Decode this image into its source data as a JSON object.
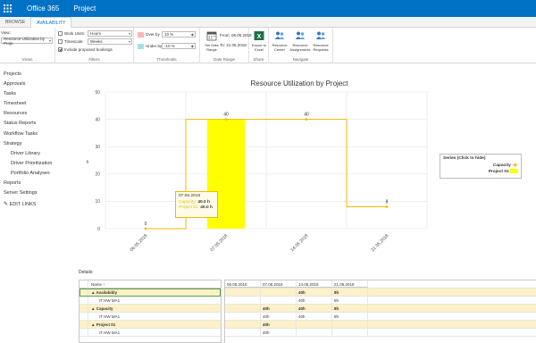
{
  "topbar": {
    "brand": "Office 365",
    "app": "Project"
  },
  "ribbon_tabs": [
    {
      "label": "BROWSE"
    },
    {
      "label": "AVAILABILITY"
    }
  ],
  "ribbon": {
    "views": {
      "view_label": "View:",
      "view_value": "Resource Utilization by Proje",
      "group_label": "Views"
    },
    "filters": {
      "work_units_label": "Work Units:",
      "work_units_value": "Hours",
      "timescale_label": "Timescale:",
      "timescale_value": "Weeks",
      "include_label": "Include proposed bookings",
      "group_label": "Filters"
    },
    "thresholds": {
      "over_label": "Over by",
      "over_value": "10 %",
      "under_label": "Under by",
      "under_value": "-10 %",
      "group_label": "Thresholds"
    },
    "date_range": {
      "button_label": "Set Date Range",
      "from_label": "From:",
      "from_value": "06.05.2018",
      "to_label": "To:",
      "to_value": "21.05.2018",
      "group_label": "Date Range"
    },
    "share": {
      "export_label": "Export to Excel",
      "group_label": "Share"
    },
    "navigate": {
      "center_label": "Resource Center",
      "assign_label": "Resource Assignments",
      "requests_label": "Resource Requests",
      "group_label": "Navigate"
    }
  },
  "quick_launch": [
    {
      "label": "Projects"
    },
    {
      "label": "Approvals"
    },
    {
      "label": "Tasks"
    },
    {
      "label": "Timesheet"
    },
    {
      "label": "Resources"
    },
    {
      "label": "Status Reports"
    },
    {
      "label": "Workflow Tasks"
    },
    {
      "label": "Strategy"
    },
    {
      "label": "Driver Library"
    },
    {
      "label": "Driver Prioritization"
    },
    {
      "label": "Portfolio Analyses"
    },
    {
      "label": "Reports"
    },
    {
      "label": "Server Settings"
    }
  ],
  "edit_links": "EDIT LINKS",
  "chart_data": {
    "type": "bar",
    "title": "Resource Utilization by Project",
    "ylabel": "h",
    "categories": [
      "06.05.2018",
      "07.05.2018",
      "14.05.2018",
      "21.05.2018"
    ],
    "ylim": [
      0,
      50
    ],
    "yticks": [
      0,
      10,
      20,
      30,
      40,
      50
    ],
    "series": [
      {
        "name": "Capacity",
        "type": "step-line",
        "color": "#f5b800",
        "values": [
          0,
          40,
          40,
          8
        ],
        "labels": [
          "0",
          "40",
          "40",
          "8"
        ]
      },
      {
        "name": "Project 01",
        "type": "bar",
        "color": "#ffff00",
        "values": [
          0,
          40,
          0,
          0
        ]
      }
    ],
    "legend": {
      "title": "Series (Click to hide)",
      "position": "right"
    },
    "tooltip": {
      "date": "07.05.2018",
      "capacity_label": "Capacity:",
      "capacity_value": "40.0 h",
      "project_label": "Project 01:",
      "project_value": "40.0 h"
    }
  },
  "details": {
    "label": "Details:",
    "left_header": "Name ↑",
    "rows": [
      {
        "name": "▲ Availability",
        "group": true,
        "selected": true
      },
      {
        "name": "IT HW MA1",
        "group": false
      },
      {
        "name": "▲ Capacity",
        "group": true
      },
      {
        "name": "IT HW MA1",
        "group": false
      },
      {
        "name": "▲ Project 01",
        "group": true
      },
      {
        "name": "IT HW MA1",
        "group": false
      }
    ],
    "columns": [
      "06.05.2018",
      "07.05.2018",
      "14.05.2018",
      "21.05.2018"
    ],
    "cells": [
      [
        "",
        "",
        "40h",
        "8h"
      ],
      [
        "",
        "",
        "40h",
        "8h"
      ],
      [
        "",
        "40h",
        "40h",
        "8h"
      ],
      [
        "",
        "40h",
        "40h",
        "8h"
      ],
      [
        "",
        "40h",
        "",
        ""
      ],
      [
        "",
        "40h",
        "",
        ""
      ]
    ]
  }
}
